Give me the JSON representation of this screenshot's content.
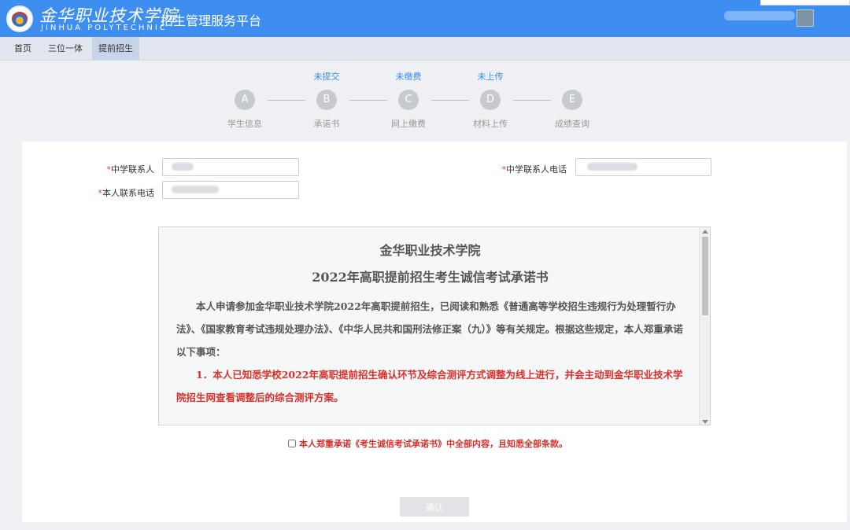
{
  "header": {
    "logo_cn": "金华职业技术学院",
    "logo_en": "JINHUA POLYTECHNIC",
    "platform_title": "招生管理服务平台"
  },
  "nav": {
    "tabs": [
      {
        "label": "首页"
      },
      {
        "label": "三位一体"
      },
      {
        "label": "提前招生",
        "active": true
      }
    ]
  },
  "steps": [
    {
      "letter": "A",
      "status": "",
      "label": "学生信息"
    },
    {
      "letter": "B",
      "status": "未提交",
      "label": "承诺书"
    },
    {
      "letter": "C",
      "status": "未缴费",
      "label": "网上缴费"
    },
    {
      "letter": "D",
      "status": "未上传",
      "label": "材料上传"
    },
    {
      "letter": "E",
      "status": "",
      "label": "成绩查询"
    }
  ],
  "form": {
    "school_contact_label": "中学联系人",
    "school_contact_phone_label": "中学联系人电话",
    "own_phone_label": "本人联系电话",
    "required_mark": "*"
  },
  "letter": {
    "title1": "金华职业技术学院",
    "title2": "2022年高职提前招生考生诚信考试承诺书",
    "para1": "本人申请参加金华职业技术学院2022年高职提前招生，已阅读和熟悉《普通高等学校招生违规行为处理暂行办法》、《国家教育考试违规处理办法》、《中华人民共和国刑法修正案（九）》等有关规定。根据这些规定，本人郑重承诺以下事项：",
    "para2": "1．本人已知悉学校2022年高职提前招生确认环节及综合测评方式调整为线上进行，并会主动到金华职业技术学院招生网查看调整后的综合测评方案。"
  },
  "agree_text": "本人郑重承诺《考生诚信考试承诺书》中全部内容，且知悉全部条款。",
  "confirm_label": "确认",
  "colors": {
    "header_bg": "#3d8ef0",
    "accent": "#3d8ef0",
    "required": "#e23a3a",
    "warning_text": "#d9302a"
  }
}
